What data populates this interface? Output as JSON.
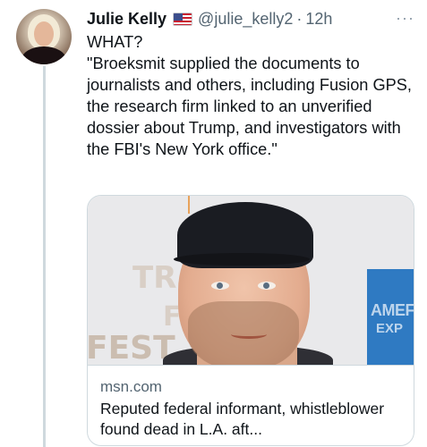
{
  "tweet": {
    "author_name": "Julie Kelly",
    "flag_icon": "us-flag-icon",
    "handle": "@julie_kelly2",
    "separator": "·",
    "time": "12h",
    "more_label": "···",
    "text_lines": [
      "WHAT?",
      "\"Broeksmit supplied the documents to journalists and others, including Fusion GPS, the research firm linked to an unverified dossier about Trump, and investigators with the FBI's New York office.\""
    ]
  },
  "card": {
    "image_text": {
      "tr": "TR",
      "f": "F",
      "fest": "FEST",
      "amex_1": "AMEF",
      "amex_2": "EXP"
    },
    "domain": "msn.com",
    "title": "Reputed federal informant, whistleblower found dead in L.A. aft..."
  },
  "colors": {
    "text": "#0f1419",
    "secondary": "#536471",
    "border": "#cfd9de"
  }
}
